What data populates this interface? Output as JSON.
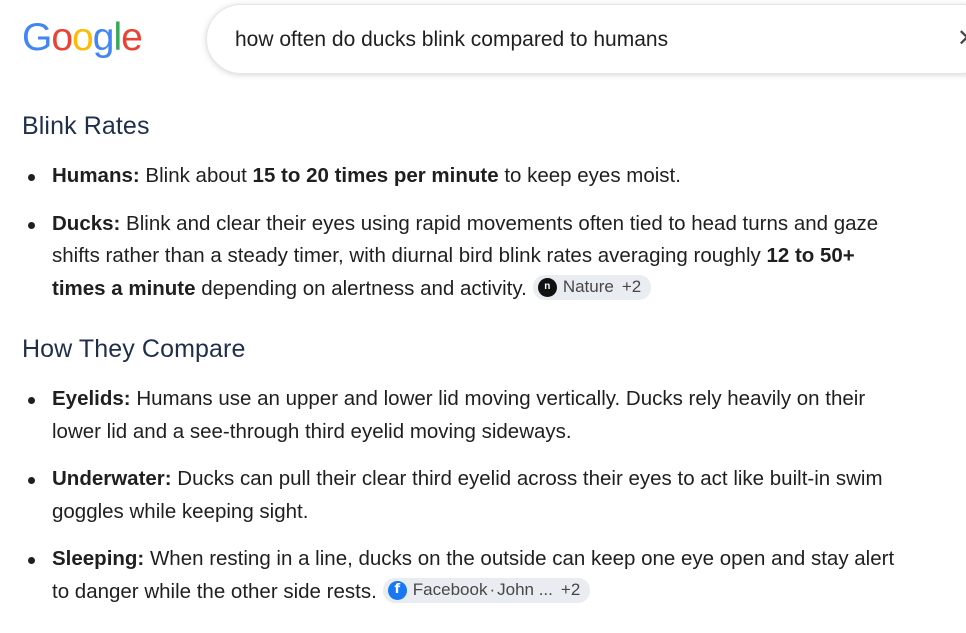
{
  "header": {
    "logo_letters": [
      "G",
      "o",
      "o",
      "g",
      "l",
      "e"
    ],
    "logo_colors": [
      "#4285F4",
      "#EA4335",
      "#FBBC05",
      "#4285F4",
      "#34A853",
      "#EA4335"
    ],
    "query": "how often do ducks blink compared to humans",
    "clear_icon": "close-icon"
  },
  "sections": {
    "blink_rates": {
      "title": "Blink Rates",
      "humans": {
        "label": "Humans:",
        "text1": " Blink about ",
        "bold1": "15 to 20 times per minute",
        "text2": " to keep eyes moist."
      },
      "ducks": {
        "label": "Ducks:",
        "text1": " Blink and clear their eyes using rapid movements often tied to head turns and gaze shifts rather than a steady timer, with diurnal bird blink rates averaging roughly ",
        "bold1": "12 to 50+ times a minute",
        "text2": " depending on alertness and activity.",
        "chip": {
          "source": "Nature",
          "more": "+2",
          "icon": "nature-icon"
        }
      }
    },
    "compare": {
      "title": "How They Compare",
      "eyelids": {
        "label": "Eyelids:",
        "text": " Humans use an upper and lower lid moving vertically. Ducks rely heavily on their lower lid and a see-through third eyelid moving sideways."
      },
      "underwater": {
        "label": "Underwater:",
        "text": " Ducks can pull their clear third eyelid across their eyes to act like built-in swim goggles while keeping sight."
      },
      "sleeping": {
        "label": "Sleeping:",
        "text": " When resting in a line, ducks on the outside can keep one eye open and stay alert to danger while the other side rests.",
        "chip": {
          "source": "Facebook",
          "separator": "·",
          "author": "John ...",
          "more": "+2",
          "icon": "facebook-icon"
        }
      }
    }
  }
}
